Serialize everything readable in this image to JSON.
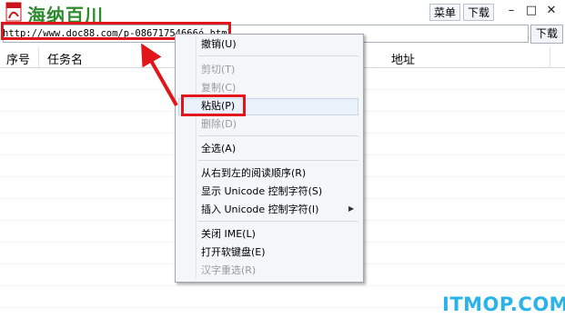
{
  "app": {
    "title": "海纳百川",
    "menu_label": "菜单",
    "download_top_label": "下载",
    "minimize_symbol": "–",
    "maximize_symbol": "□",
    "close_symbol": "✕"
  },
  "urlbar": {
    "value": "http://www.doc88.com/p-08671754666ó.html",
    "download_label": "下载"
  },
  "table": {
    "columns": [
      "序号",
      "任务名",
      "地址"
    ]
  },
  "context_menu": {
    "items": [
      {
        "label": "撤销(U)",
        "disabled": false
      },
      {
        "label": "剪切(T)",
        "disabled": true
      },
      {
        "label": "复制(C)",
        "disabled": true
      },
      {
        "label": "粘贴(P)",
        "disabled": false
      },
      {
        "label": "删除(D)",
        "disabled": true
      },
      {
        "label": "全选(A)",
        "disabled": false
      },
      {
        "label": "从右到左的阅读顺序(R)",
        "disabled": false
      },
      {
        "label": "显示 Unicode 控制字符(S)",
        "disabled": false
      },
      {
        "label": "插入 Unicode 控制字符(I)",
        "disabled": false
      },
      {
        "label": "关闭 IME(L)",
        "disabled": false
      },
      {
        "label": "打开软键盘(E)",
        "disabled": false
      },
      {
        "label": "汉字重选(R)",
        "disabled": true
      }
    ]
  },
  "watermark": "ITMOP.COM",
  "colors": {
    "highlight_red": "#e2151b",
    "title_green": "#2d8a2d",
    "watermark_blue": "#2ab3e8"
  }
}
